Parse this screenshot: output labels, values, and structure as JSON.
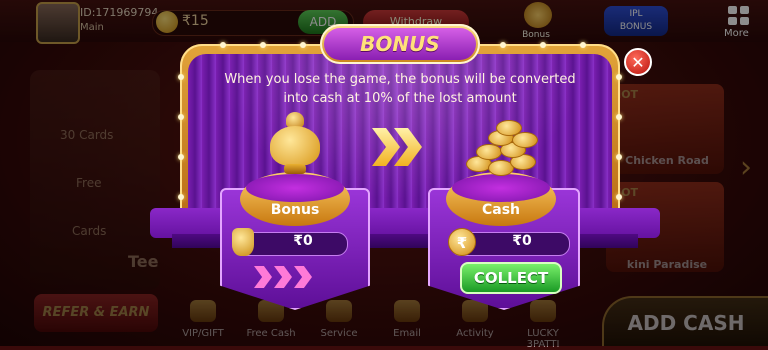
{
  "header": {
    "user_id": "ID:171969794",
    "account_label": "Main",
    "balance": "₹15",
    "add_label": "ADD",
    "withdraw_label": "Withdraw",
    "bonus_label": "Bonus",
    "ipl_line1": "IPL",
    "ipl_line2": "BONUS",
    "more_label": "More"
  },
  "left_menu": [
    "30 Cards",
    "Free",
    "Cards"
  ],
  "left_game_label": "Tee",
  "right_games": [
    {
      "badge": "HOT",
      "name": "Chicken Road"
    },
    {
      "badge": "HOT",
      "name": "kini Paradise"
    }
  ],
  "bottom_nav": {
    "refer_label": "REFER & EARN",
    "items": [
      "VIP/GIFT",
      "Free Cash",
      "Service",
      "Email",
      "Activity",
      "LUCKY 3PATTI"
    ],
    "add_cash_label": "ADD CASH"
  },
  "modal": {
    "title": "BONUS",
    "close_symbol": "✕",
    "description": "When you lose the game, the bonus will be converted into cash at 10% of the lost amount",
    "left": {
      "label": "Bonus",
      "amount": "₹0",
      "icon": "pot-icon"
    },
    "right": {
      "label": "Cash",
      "amount": "₹0",
      "currency_symbol": "₹",
      "icon": "coins-icon"
    },
    "collect_label": "COLLECT"
  },
  "colors": {
    "curtain_purple": "#7a1fb0",
    "frame_gold": "#e2a43a",
    "collect_green": "#1a9a25",
    "close_red": "#b8120c"
  }
}
